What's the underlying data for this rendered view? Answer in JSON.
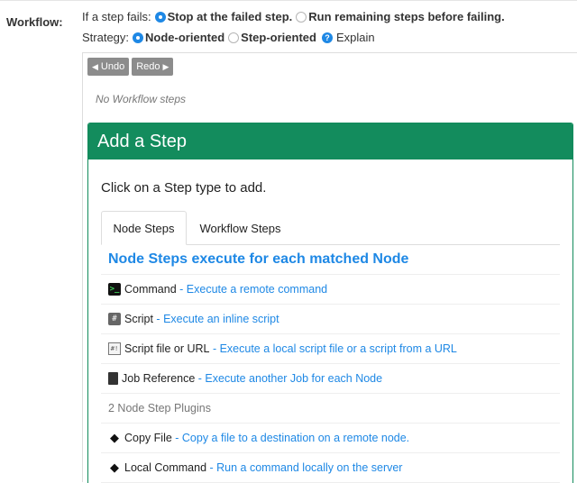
{
  "workflow": {
    "label": "Workflow:",
    "failure": {
      "prefix": "If a step fails:",
      "options": [
        {
          "label": "Stop at the failed step.",
          "selected": true
        },
        {
          "label": "Run remaining steps before failing.",
          "selected": false
        }
      ]
    },
    "strategy": {
      "prefix": "Strategy:",
      "options": [
        {
          "label": "Node-oriented",
          "selected": true
        },
        {
          "label": "Step-oriented",
          "selected": false
        }
      ],
      "explain": "Explain"
    }
  },
  "toolbar": {
    "undo": "Undo",
    "redo": "Redo"
  },
  "empty_message": "No Workflow steps",
  "add_step": {
    "title": "Add a Step",
    "instruction": "Click on a Step type to add.",
    "tabs": [
      "Node Steps",
      "Workflow Steps"
    ],
    "section_title": "Node Steps execute for each matched Node",
    "steps": [
      {
        "icon": "terminal-icon",
        "name": "Command",
        "desc": "Execute a remote command"
      },
      {
        "icon": "script-icon",
        "name": "Script",
        "desc": "Execute an inline script"
      },
      {
        "icon": "script-file-icon",
        "name": "Script file or URL",
        "desc": "Execute a local script file or a script from a URL"
      },
      {
        "icon": "book-icon",
        "name": "Job Reference",
        "desc": "Execute another Job for each Node"
      }
    ],
    "plugins_header": "2 Node Step Plugins",
    "plugins": [
      {
        "icon": "diamond-icon",
        "name": "Copy File",
        "desc": "Copy a file to a destination on a remote node."
      },
      {
        "icon": "diamond-icon",
        "name": "Local Command",
        "desc": "Run a command locally on the server"
      }
    ]
  },
  "colors": {
    "accent": "#1e88e5",
    "header_green": "#138c5d"
  }
}
